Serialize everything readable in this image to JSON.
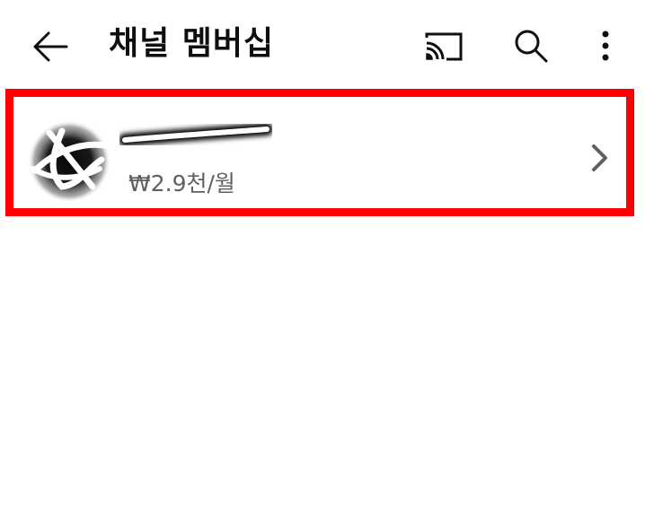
{
  "header": {
    "title": "채널 멤버십",
    "icons": {
      "back": "arrow-left-icon",
      "cast": "cast-icon",
      "search": "search-icon",
      "more": "more-vertical-icon"
    }
  },
  "membership": {
    "price": "₩2.9천/월",
    "icons": {
      "chevron": "chevron-right-icon"
    }
  },
  "colors": {
    "highlight_border": "#ff0000",
    "primary_text": "#0f0f0f",
    "secondary_text": "#606060",
    "chevron": "#606060"
  }
}
